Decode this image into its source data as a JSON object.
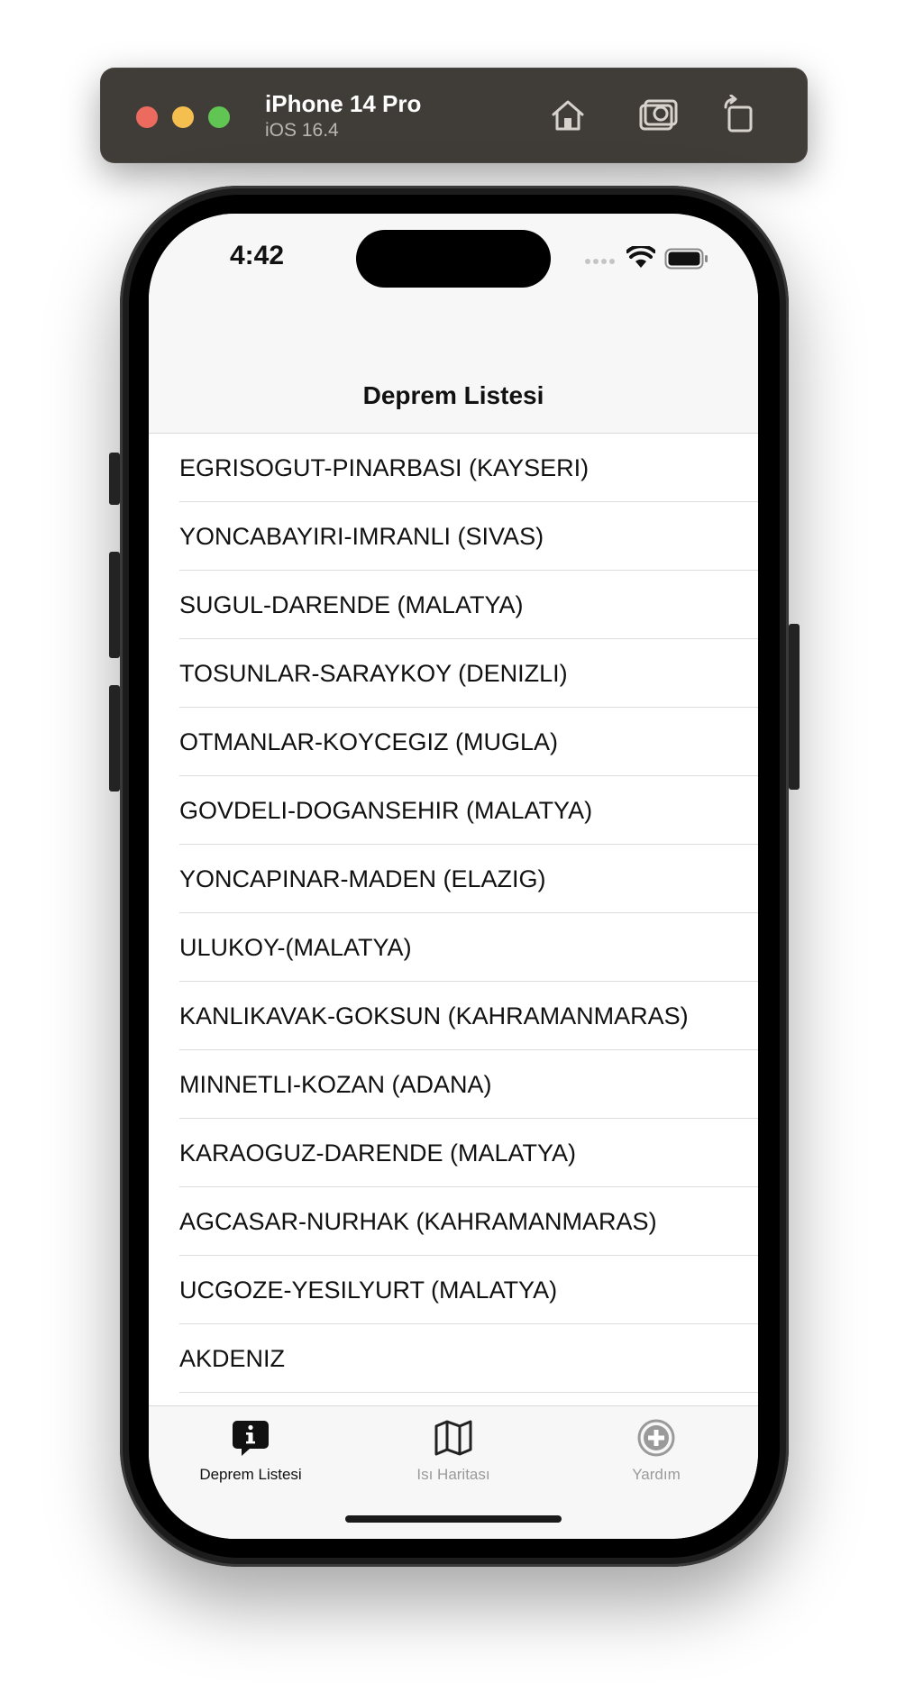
{
  "simulator": {
    "device_name": "iPhone 14 Pro",
    "os_version": "iOS 16.4",
    "home_icon": "home-icon",
    "screenshot_icon": "camera-icon",
    "rotate_icon": "rotate-icon"
  },
  "status_bar": {
    "time": "4:42",
    "signal_icon": "cellular-dots-icon",
    "wifi_icon": "wifi-icon",
    "battery_icon": "battery-icon"
  },
  "nav": {
    "title": "Deprem Listesi"
  },
  "list": {
    "items": [
      "EGRISOGUT-PINARBASI (KAYSERI)",
      "YONCABAYIRI-IMRANLI (SIVAS)",
      "SUGUL-DARENDE (MALATYA)",
      "TOSUNLAR-SARAYKOY (DENIZLI)",
      "OTMANLAR-KOYCEGIZ (MUGLA)",
      "GOVDELI-DOGANSEHIR (MALATYA)",
      "YONCAPINAR-MADEN (ELAZIG)",
      "ULUKOY-(MALATYA)",
      "KANLIKAVAK-GOKSUN (KAHRAMANMARAS)",
      "MINNETLI-KOZAN (ADANA)",
      "KARAOGUZ-DARENDE (MALATYA)",
      "AGCASAR-NURHAK (KAHRAMANMARAS)",
      "UCGOZE-YESILYURT (MALATYA)",
      "AKDENIZ"
    ]
  },
  "tab_bar": {
    "tabs": [
      {
        "label": "Deprem Listesi",
        "icon": "info-bubble-icon",
        "active": true
      },
      {
        "label": "Isı Haritası",
        "icon": "map-icon",
        "active": false
      },
      {
        "label": "Yardım",
        "icon": "plus-circle-icon",
        "active": false
      }
    ]
  },
  "colors": {
    "toolbar_bg": "#403d39",
    "active_tab": "#111111",
    "inactive_tab": "#9a9a9a"
  }
}
